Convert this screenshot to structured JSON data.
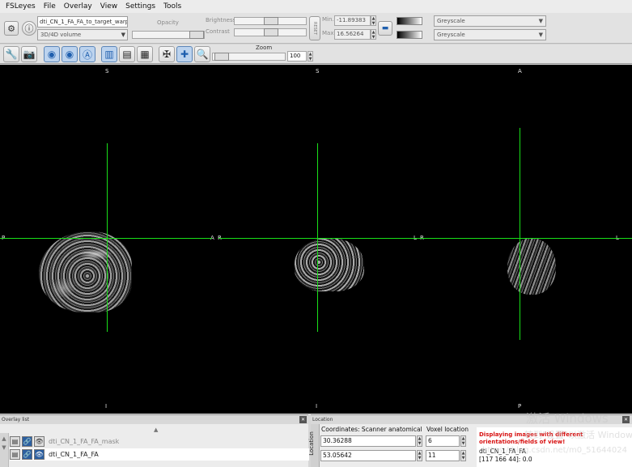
{
  "app": {
    "title": "FSLeyes"
  },
  "menu": [
    "FSLeyes",
    "File",
    "Overlay",
    "View",
    "Settings",
    "Tools"
  ],
  "overlay_toolbar": {
    "overlay_name": "dti_CN_1_FA_FA_to_target_warp",
    "overlay_type": "3D/4D volume",
    "opacity_label": "Opacity",
    "brightness_label": "Brightness",
    "contrast_label": "Contrast",
    "min_label": "Min.",
    "max_label": "Max.",
    "min_value": "-11.89383",
    "max_value": "16.56264",
    "reset_label": "RESET",
    "colormap_1": "Greyscale",
    "colormap_2": "Greyscale"
  },
  "view_toolbar": {
    "zoom_label": "Zoom",
    "zoom_value": "100"
  },
  "viewer": {
    "sagittal": {
      "top": "S",
      "bottom": "I",
      "left": "P",
      "right": "A"
    },
    "coronal": {
      "top": "S",
      "bottom": "I",
      "left": "R",
      "right": "L"
    },
    "axial": {
      "top": "A",
      "bottom": "P",
      "left": "R",
      "right": "L"
    },
    "cursor_color": "#19e019"
  },
  "overlay_list": {
    "title": "Overlay list",
    "items": [
      {
        "name": "dti_CN_1_FA_FA_mask",
        "selected": false
      },
      {
        "name": "dti_CN_1_FA_FA",
        "selected": true
      }
    ]
  },
  "location": {
    "title": "Location",
    "side_label": "Location",
    "coords_header": "Coordinates: Scanner anatomical",
    "voxel_header": "Voxel location",
    "coord_x": "30.36288",
    "coord_y": "53.05642",
    "voxel_x": "6",
    "voxel_y": "11",
    "warning": "Displaying images with different orientations/fields of view!",
    "info_name": "dti_CN_1_FA_FA",
    "info_value": "[117 166 44]: 0.0"
  },
  "watermark": {
    "line1": "激活 Windows",
    "line2": "转到\"设置\"以激活 Windows。",
    "url": "https://blog.csdn.net/m0_51644024"
  }
}
